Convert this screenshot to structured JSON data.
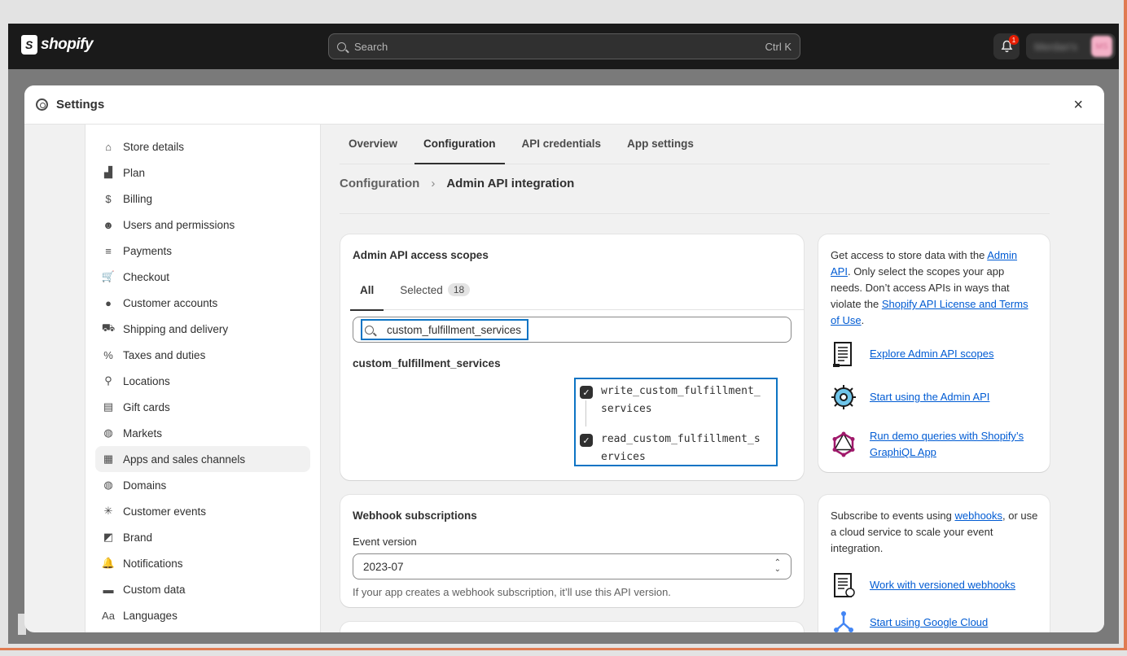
{
  "topbar": {
    "brand": "shopify",
    "search_placeholder": "Search",
    "search_shortcut": "Ctrl K",
    "notification_count": "1",
    "account_name": "Merdan's",
    "account_initials": "MS"
  },
  "modal": {
    "title": "Settings",
    "close": "×"
  },
  "sidebar": {
    "items": [
      {
        "label": "Store details",
        "icon": "store-icon"
      },
      {
        "label": "Plan",
        "icon": "plan-icon"
      },
      {
        "label": "Billing",
        "icon": "billing-icon"
      },
      {
        "label": "Users and permissions",
        "icon": "users-icon"
      },
      {
        "label": "Payments",
        "icon": "payments-icon"
      },
      {
        "label": "Checkout",
        "icon": "cart-icon"
      },
      {
        "label": "Customer accounts",
        "icon": "person-icon"
      },
      {
        "label": "Shipping and delivery",
        "icon": "truck-icon"
      },
      {
        "label": "Taxes and duties",
        "icon": "tax-icon"
      },
      {
        "label": "Locations",
        "icon": "location-icon"
      },
      {
        "label": "Gift cards",
        "icon": "gift-card-icon"
      },
      {
        "label": "Markets",
        "icon": "globe-icon"
      },
      {
        "label": "Apps and sales channels",
        "icon": "apps-icon",
        "active": true
      },
      {
        "label": "Domains",
        "icon": "globe-icon"
      },
      {
        "label": "Customer events",
        "icon": "cursor-icon"
      },
      {
        "label": "Brand",
        "icon": "brand-icon"
      },
      {
        "label": "Notifications",
        "icon": "bell-icon"
      },
      {
        "label": "Custom data",
        "icon": "folder-icon"
      },
      {
        "label": "Languages",
        "icon": "language-icon"
      }
    ]
  },
  "tabs": [
    "Overview",
    "Configuration",
    "API credentials",
    "App settings"
  ],
  "breadcrumb": {
    "parent": "Configuration",
    "current": "Admin API integration"
  },
  "scopes": {
    "title": "Admin API access scopes",
    "tab_all": "All",
    "tab_selected": "Selected",
    "selected_count": "18",
    "search_value": "custom_fulfillment_services",
    "group": "custom_fulfillment_services",
    "permissions": [
      "write_custom_fulfillment_services",
      "read_custom_fulfillment_services"
    ],
    "checked": [
      true,
      true
    ]
  },
  "info1": {
    "text_1": "Get access to store data with the ",
    "link_1": "Admin API",
    "text_2": ". Only select the scopes your app needs. Don’t access APIs in ways that violate the ",
    "link_2": "Shopify API License and Terms of Use",
    "text_3": ".",
    "resources": [
      {
        "label": "Explore Admin API scopes",
        "icon": "scroll-icon"
      },
      {
        "label": "Start using the Admin API",
        "icon": "gear-badge-icon"
      },
      {
        "label": "Run demo queries with Shopify’s GraphiQL App",
        "icon": "graphql-icon"
      }
    ]
  },
  "webhook": {
    "title": "Webhook subscriptions",
    "event_label": "Event version",
    "event_value": "2023-07",
    "help": "If your app creates a webhook subscription, it’ll use this API version."
  },
  "info2": {
    "text_1": "Subscribe to events using ",
    "link_1": "webhooks",
    "text_2": ", or use a cloud service to scale your event integration.",
    "resources": [
      {
        "label": "Work with versioned webhooks",
        "icon": "scroll-icon"
      },
      {
        "label": "Start using Google Cloud",
        "icon": "cloud-icon"
      }
    ]
  },
  "colors": {
    "link": "#005bd3",
    "highlight": "#0c74c4",
    "topbar": "#1a1a1a"
  }
}
